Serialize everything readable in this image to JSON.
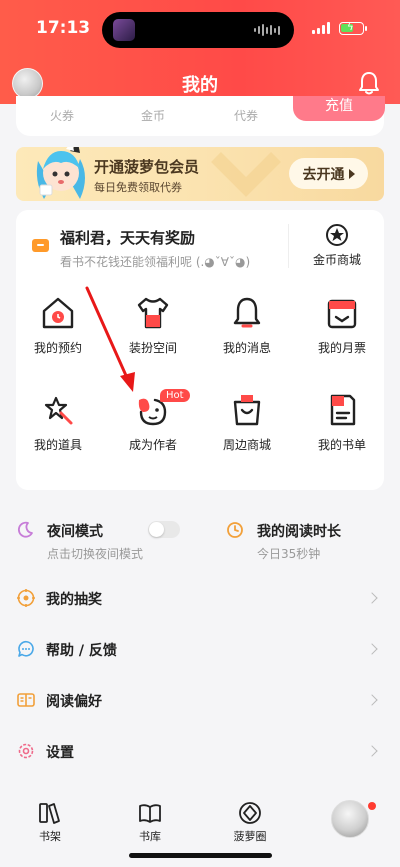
{
  "status_bar": {
    "time": "17:13"
  },
  "header": {
    "title": "我的"
  },
  "currency": {
    "items": [
      {
        "label": "火券"
      },
      {
        "label": "金币"
      },
      {
        "label": "代券"
      }
    ],
    "action_label": "充值"
  },
  "vip": {
    "title": "开通菠萝包会员",
    "subtitle": "每日免费领取代券",
    "button_label": "去开通"
  },
  "welfare": {
    "title": "福利君，天天有奖励",
    "subtitle": "看书不花钱还能领福利呢 (.◕ˇ∀ˇ◕)",
    "mall_label": "金币商城"
  },
  "grid": [
    {
      "label": "我的预约"
    },
    {
      "label": "装扮空间"
    },
    {
      "label": "我的消息"
    },
    {
      "label": "我的月票"
    },
    {
      "label": "我的道具"
    },
    {
      "label": "成为作者",
      "badge": "Hot"
    },
    {
      "label": "周边商城"
    },
    {
      "label": "我的书单"
    }
  ],
  "settings_row": {
    "night_title": "夜间模式",
    "night_sub": "点击切换夜间模式",
    "night_enabled": false,
    "read_title": "我的阅读时长",
    "read_sub": "今日35秒钟"
  },
  "menu": [
    {
      "label": "我的抽奖",
      "icon": "lottery-icon"
    },
    {
      "label": "帮助 / 反馈",
      "icon": "help-icon"
    },
    {
      "label": "阅读偏好",
      "icon": "reading-preference-icon"
    },
    {
      "label": "设置",
      "icon": "settings-icon"
    }
  ],
  "tabbar": [
    {
      "label": "书架"
    },
    {
      "label": "书库"
    },
    {
      "label": "菠萝圈"
    }
  ],
  "colors": {
    "accent": "#ff4a48",
    "gold": "#f8d99f"
  }
}
